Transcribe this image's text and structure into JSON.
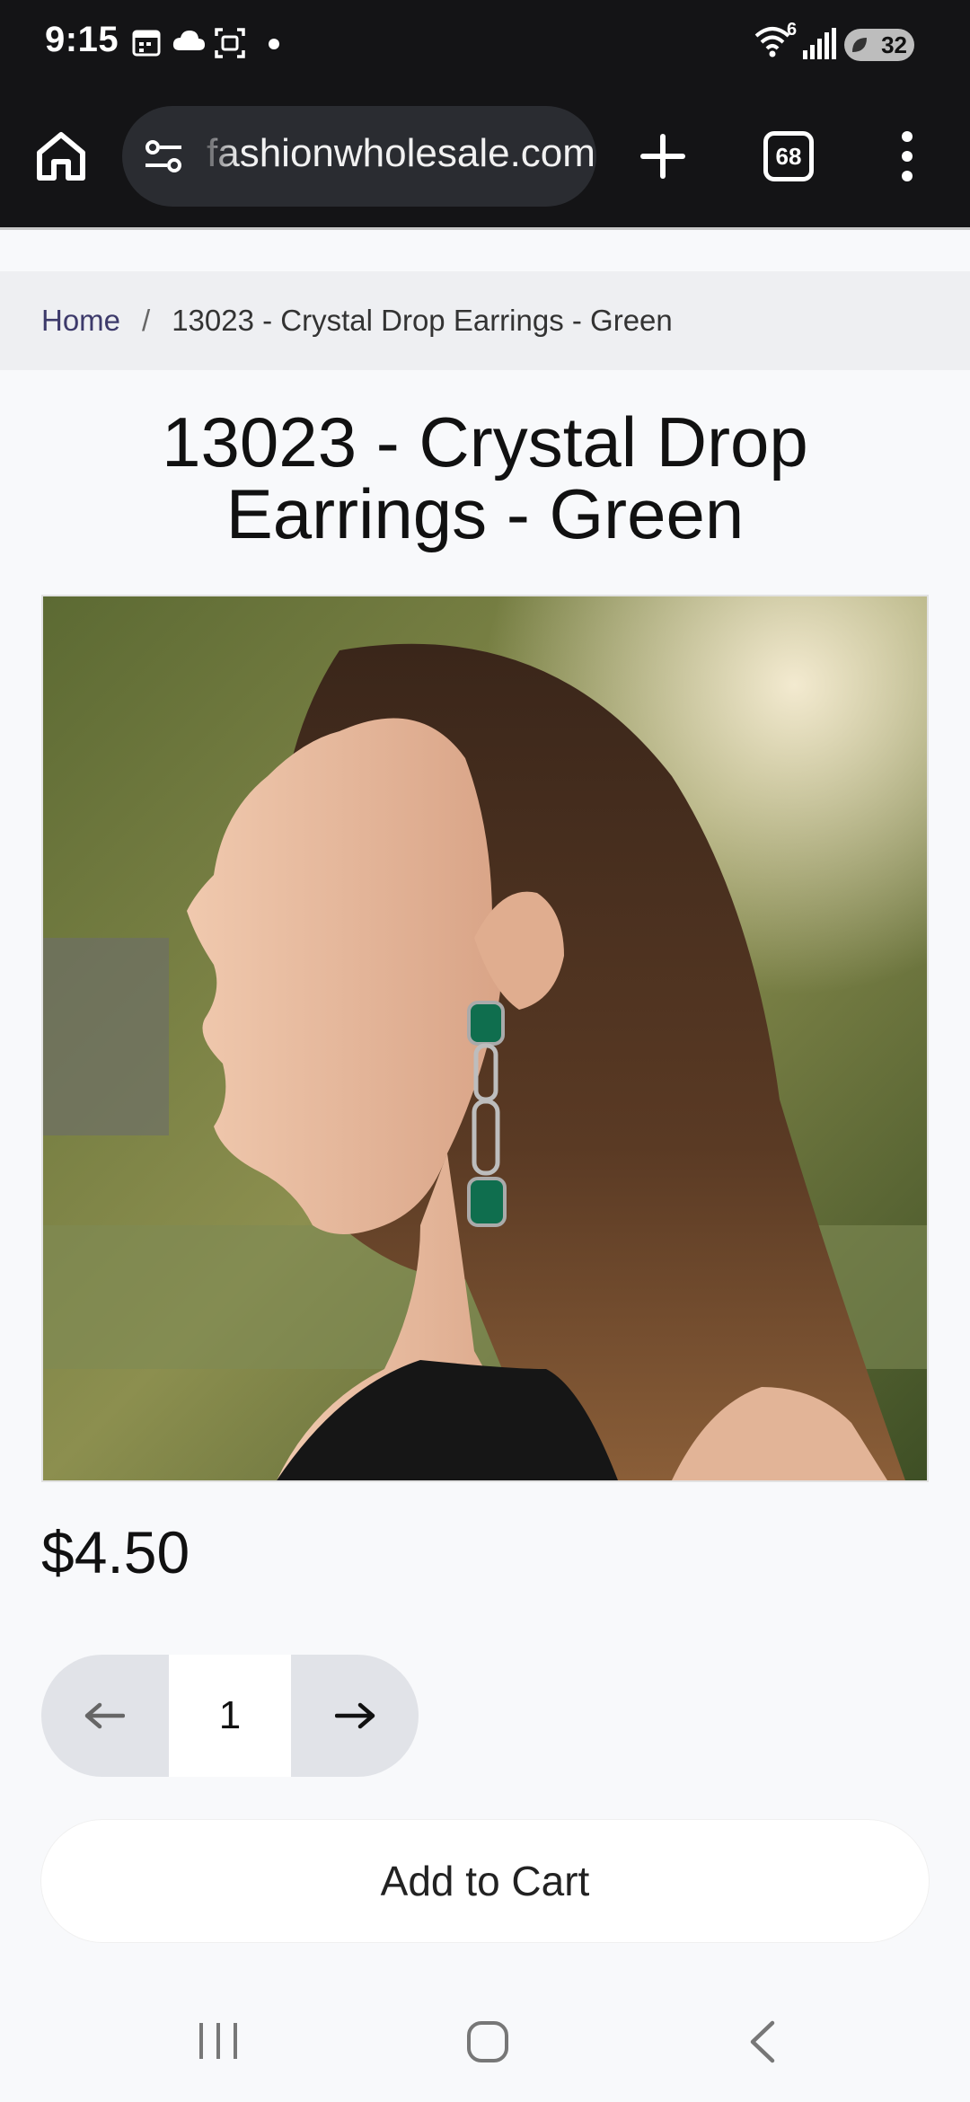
{
  "status_bar": {
    "time": "9:15",
    "wifi_badge": "6",
    "battery": "32"
  },
  "browser": {
    "url": "fashionwholesale.com",
    "tab_count": "68"
  },
  "breadcrumb": {
    "home": "Home",
    "separator": "/",
    "current": "13023 - Crystal Drop Earrings - Green"
  },
  "product": {
    "title": "13023 - Crystal Drop Earrings - Green",
    "price": "$4.50",
    "quantity": "1",
    "add_to_cart": "Add to Cart"
  },
  "colors": {
    "topbar": "#141416",
    "breadcrumb_link": "#3d3a6b",
    "stepper_bg": "#e1e3e8"
  }
}
